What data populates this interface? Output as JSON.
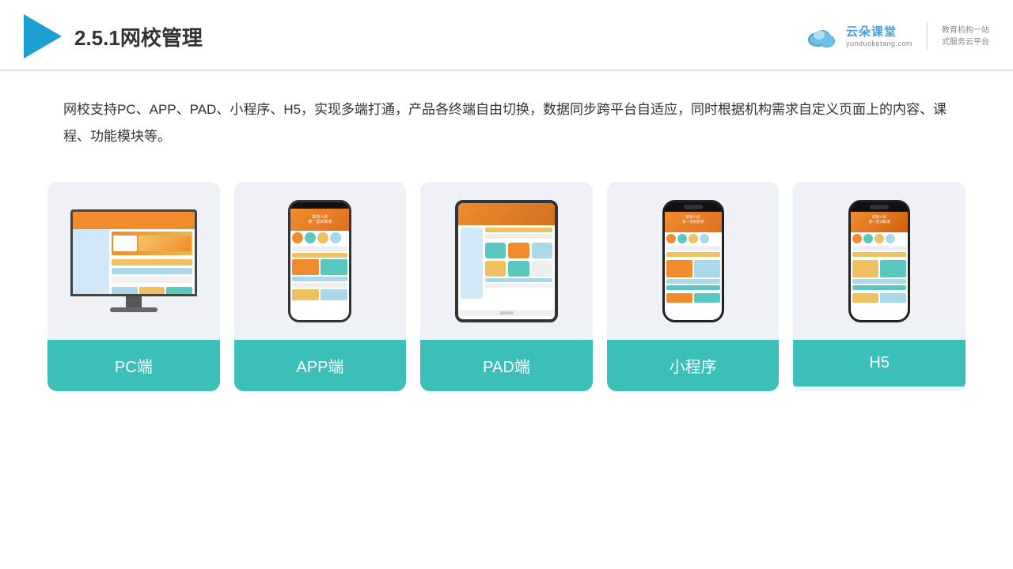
{
  "header": {
    "title": "2.5.1网校管理",
    "logo": {
      "main": "云朵课堂",
      "sub": "yunduoketang.com",
      "tagline": "教育机构一站\n式服务云平台"
    }
  },
  "description": "网校支持PC、APP、PAD、小程序、H5，实现多端打通，产品各终端自由切换，数据同步跨平台自适应，同时根据机构需求自定义页面上的内容、课程、功能模块等。",
  "cards": [
    {
      "id": "pc",
      "label": "PC端"
    },
    {
      "id": "app",
      "label": "APP端"
    },
    {
      "id": "pad",
      "label": "PAD端"
    },
    {
      "id": "miniapp",
      "label": "小程序"
    },
    {
      "id": "h5",
      "label": "H5"
    }
  ],
  "colors": {
    "accent": "#3bbfb8",
    "header_line": "#e0e0e0",
    "text_main": "#333333",
    "logo_blue": "#4a9fd4"
  }
}
